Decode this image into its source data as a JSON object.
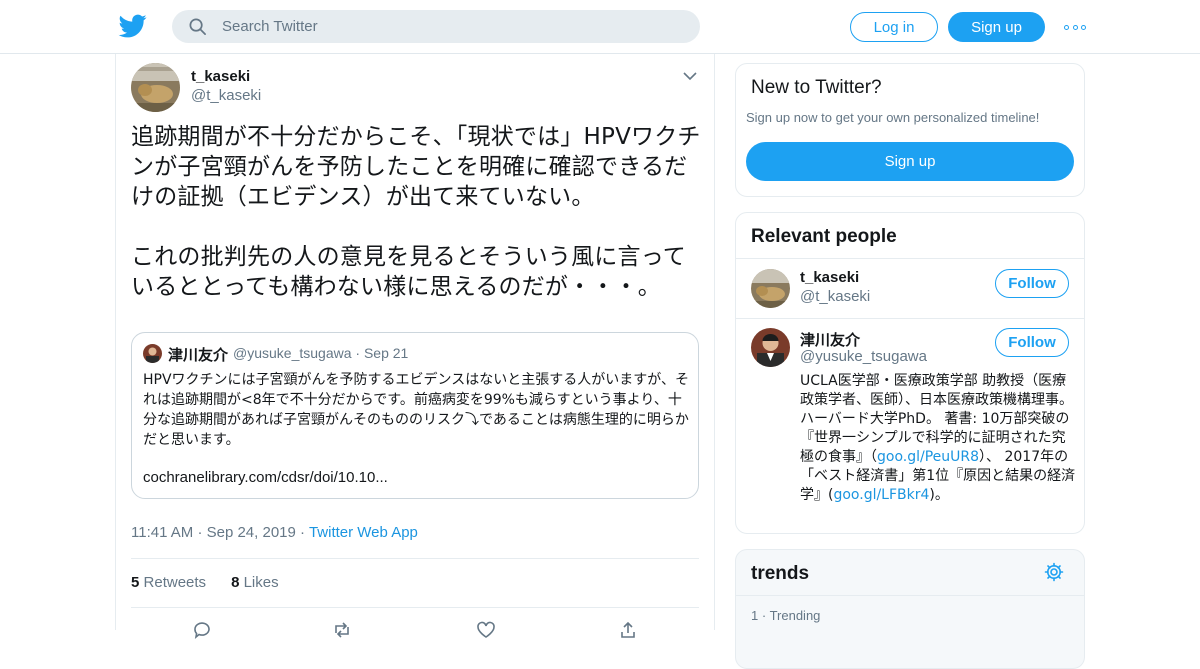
{
  "header": {
    "search_placeholder": "Search Twitter",
    "login_label": "Log in",
    "signup_label": "Sign up"
  },
  "tweet": {
    "author_name": "t_kaseki",
    "author_handle": "@t_kaseki",
    "text": "追跡期間が不十分だからこそ、「現状では」HPVワクチンが子宮頸がんを予防したことを明確に確認できるだけの証拠（エビデンス）が出て来ていない。\n\nこれの批判先の人の意見を見るとそういう風に言っているととっても構わない様に思えるのだが・・・。",
    "time": "11:41 AM",
    "date": "Sep 24, 2019",
    "via": "Twitter Web App",
    "retweets_count": "5",
    "retweets_label": "Retweets",
    "likes_count": "8",
    "likes_label": "Likes"
  },
  "quoted_tweet": {
    "author_name": "津川友介",
    "author_handle": "@yusuke_tsugawa",
    "date": "Sep 21",
    "text": "HPVワクチンには子宮頸がんを予防するエビデンスはないと主張する人がいますが、それは追跡期間が<8年で不十分だからです。前癌病変を99%も減らすという事より、十分な追跡期間があれば子宮頸がんそのもののリスク⤵であることは病態生理的に明らかだと思います。",
    "link": "cochranelibrary.com/cdsr/doi/10.10..."
  },
  "new_to_twitter": {
    "title": "New to Twitter?",
    "subtitle": "Sign up now to get your own personalized timeline!",
    "button_label": "Sign up"
  },
  "relevant_people": {
    "title": "Relevant people",
    "people": [
      {
        "name": "t_kaseki",
        "handle": "@t_kaseki",
        "follow_label": "Follow"
      },
      {
        "name": "津川友介",
        "handle": "@yusuke_tsugawa",
        "follow_label": "Follow",
        "bio_1": "UCLA医学部・医療政策学部 助教授（医療政策学者、医師）、日本医療政策機構理事。ハーバード大学PhD。 著書: 10万部突破の『世界一シンプルで科学的に証明された究極の食事』（",
        "bio_link_1": "goo.gl/PeuUR8",
        "bio_2": "）、 2017年の「ベスト経済書」第1位『原因と結果の経済学』(",
        "bio_link_2": "goo.gl/LFBkr4",
        "bio_3": ")。"
      }
    ]
  },
  "trends": {
    "title": "trends",
    "items": [
      {
        "rank": "1",
        "label": "Trending"
      }
    ]
  },
  "colors": {
    "accent": "#1da1f2",
    "link": "#1b95e0",
    "muted": "#657786",
    "border": "#e6ecf0"
  }
}
